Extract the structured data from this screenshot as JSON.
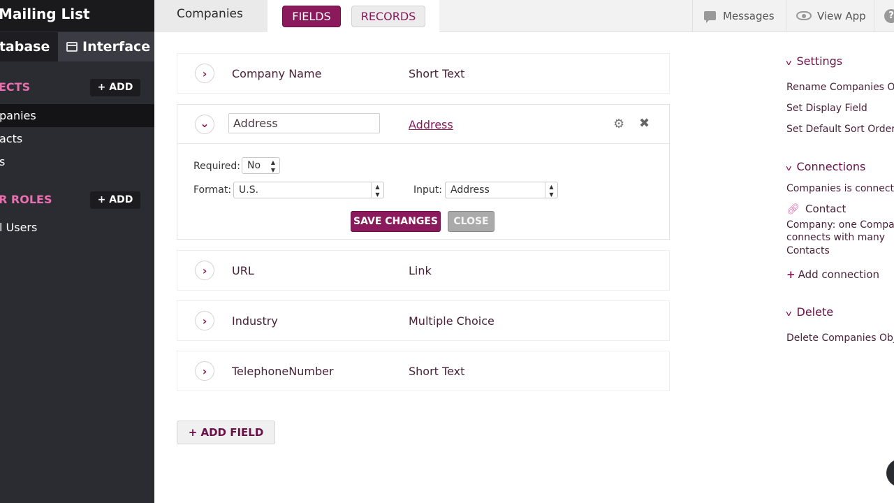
{
  "sidebar": {
    "app_title": "Mailing List",
    "tabs": {
      "database": "atabase",
      "interface": "Interface"
    },
    "objects_header": "ECTS",
    "objects_add": "+ ADD",
    "objects": [
      {
        "label": "panies"
      },
      {
        "label": "acts"
      },
      {
        "label": "s"
      }
    ],
    "roles_header": "R ROLES",
    "roles_add": "+ ADD",
    "roles": [
      {
        "label": "l Users"
      }
    ]
  },
  "topbar": {
    "object_tab": "Companies",
    "fields_label": "FIELDS",
    "records_label": "RECORDS",
    "messages_label": "Messages",
    "view_app_label": "View App",
    "help_label": "?"
  },
  "fields": [
    {
      "name": "Company Name",
      "type": "Short Text"
    },
    {
      "name": "URL",
      "type": "Link"
    },
    {
      "name": "Industry",
      "type": "Multiple Choice"
    },
    {
      "name": "TelephoneNumber",
      "type": "Short Text"
    }
  ],
  "editing": {
    "name_value": "Address",
    "type": "Address",
    "required_label": "Required:",
    "required_value": "No",
    "format_label": "Format:",
    "format_value": "U.S.",
    "input_label": "Input:",
    "input_value": "Address",
    "save_label": "SAVE CHANGES",
    "close_label": "CLOSE"
  },
  "add_field_label": "+ ADD FIELD",
  "right_panel": {
    "settings_header": "Settings",
    "settings_links": [
      "Rename Companies Ob",
      "Set Display Field",
      "Set Default Sort Order"
    ],
    "connections_header": "Connections",
    "connections_intro": "Companies is connecte",
    "connection_name": "Contact",
    "connection_desc": [
      "Company: one Compar",
      "connects with many",
      "Contacts"
    ],
    "add_connection_label": "Add connection",
    "delete_header": "Delete",
    "delete_link": "Delete Companies Obje"
  },
  "colors": {
    "brand": "#8a1a5c",
    "sidebar": "#2b2c32",
    "sidebar_accent": "#ea6fb0"
  }
}
